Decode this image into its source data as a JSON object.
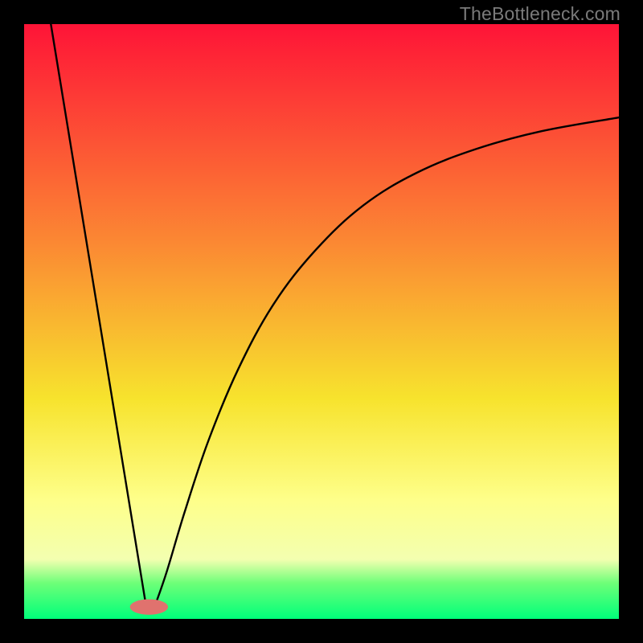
{
  "watermark": "TheBottleneck.com",
  "colors": {
    "top": "#fe1437",
    "mid_upper": "#fb8933",
    "mid": "#f7e32d",
    "mid_lower": "#feff8a",
    "low_band": "#f3ffb0",
    "green_band": "#6dff78",
    "bottom": "#00ff7a",
    "curve": "#000000",
    "marker": "#e0726e",
    "frame": "#000000"
  },
  "chart_data": {
    "type": "line",
    "title": "",
    "xlabel": "",
    "ylabel": "",
    "xlim": [
      0,
      100
    ],
    "ylim": [
      0,
      100
    ],
    "marker": {
      "x": 21,
      "y": 2,
      "rx": 3.2,
      "ry": 1.3
    },
    "series": [
      {
        "name": "bottleneck-curve",
        "points": [
          {
            "x": 4.5,
            "y": 100
          },
          {
            "x": 20.5,
            "y": 2.2
          },
          {
            "x": 22.0,
            "y": 2.2
          },
          {
            "x": 24.0,
            "y": 8
          },
          {
            "x": 27.0,
            "y": 18
          },
          {
            "x": 31.0,
            "y": 30
          },
          {
            "x": 36.0,
            "y": 42
          },
          {
            "x": 42.0,
            "y": 53
          },
          {
            "x": 49.0,
            "y": 62
          },
          {
            "x": 57.0,
            "y": 69.5
          },
          {
            "x": 66.0,
            "y": 75
          },
          {
            "x": 76.0,
            "y": 79
          },
          {
            "x": 87.0,
            "y": 82
          },
          {
            "x": 100.0,
            "y": 84.3
          }
        ]
      }
    ],
    "gradient_stops": [
      {
        "offset": 0,
        "key": "top"
      },
      {
        "offset": 37,
        "key": "mid_upper"
      },
      {
        "offset": 63,
        "key": "mid"
      },
      {
        "offset": 80,
        "key": "mid_lower"
      },
      {
        "offset": 90,
        "key": "low_band"
      },
      {
        "offset": 94,
        "key": "green_band"
      },
      {
        "offset": 100,
        "key": "bottom"
      }
    ]
  }
}
